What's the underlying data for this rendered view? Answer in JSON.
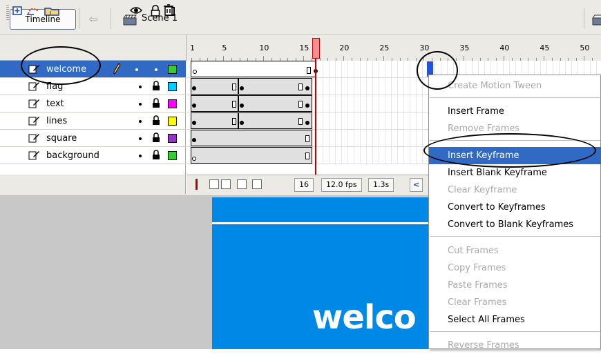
{
  "topbar": {
    "timeline_label": "Timeline",
    "scene_label": "Scene 1",
    "back_icon": "back-arrow-icon"
  },
  "ruler": {
    "numbers": [
      "1",
      "5",
      "10",
      "15",
      "20",
      "25",
      "30",
      "35",
      "40",
      "45",
      "50"
    ]
  },
  "layers": [
    {
      "name": "welcome",
      "color": "#33cc33",
      "selected": true,
      "locked": false
    },
    {
      "name": "flag",
      "color": "#00ccff",
      "selected": false,
      "locked": true
    },
    {
      "name": "text",
      "color": "#ff00ff",
      "selected": false,
      "locked": true
    },
    {
      "name": "lines",
      "color": "#ffff00",
      "selected": false,
      "locked": true
    },
    {
      "name": "square",
      "color": "#9933cc",
      "selected": false,
      "locked": true
    },
    {
      "name": "background",
      "color": "#33cc33",
      "selected": false,
      "locked": true
    }
  ],
  "status": {
    "current_frame": "16",
    "frame_rate": "12.0 fps",
    "elapsed_time": "1.3s"
  },
  "stage": {
    "welcome_text": "welco"
  },
  "context_menu": {
    "items": [
      {
        "label": "Create Motion Tween",
        "enabled": false
      },
      {
        "label": "Insert Frame",
        "enabled": true
      },
      {
        "label": "Remove Frames",
        "enabled": false
      },
      {
        "label": "Insert Keyframe",
        "enabled": true,
        "highlighted": true
      },
      {
        "label": "Insert Blank Keyframe",
        "enabled": true
      },
      {
        "label": "Clear Keyframe",
        "enabled": false
      },
      {
        "label": "Convert to Keyframes",
        "enabled": true
      },
      {
        "label": "Convert to Blank Keyframes",
        "enabled": true
      },
      {
        "label": "Cut Frames",
        "enabled": false
      },
      {
        "label": "Copy Frames",
        "enabled": false
      },
      {
        "label": "Paste Frames",
        "enabled": false
      },
      {
        "label": "Clear Frames",
        "enabled": false
      },
      {
        "label": "Select All Frames",
        "enabled": true
      },
      {
        "label": "Reverse Frames",
        "enabled": false
      }
    ]
  },
  "colors": {
    "selection": "#316ac5",
    "stage_blue": "#0088e6",
    "playhead": "#c00000"
  }
}
